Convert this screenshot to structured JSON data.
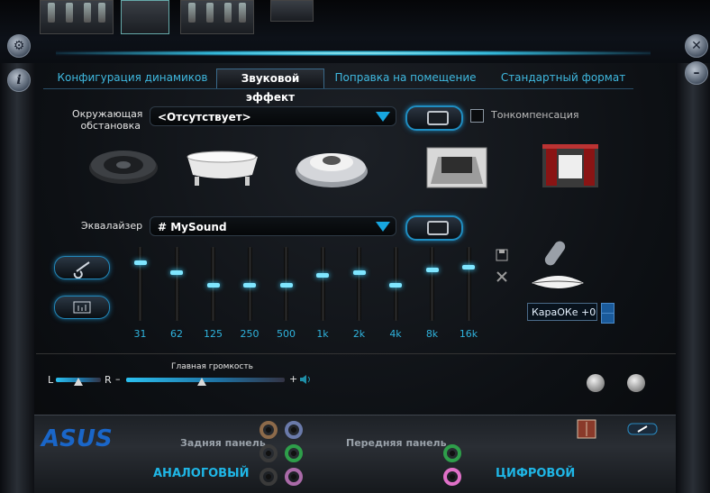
{
  "tabs": [
    {
      "label": "Конфигурация динамиков",
      "active": false
    },
    {
      "label": "Звуковой эффект",
      "active": true
    },
    {
      "label": "Поправка на помещение",
      "active": false
    },
    {
      "label": "Стандартный формат",
      "active": false
    }
  ],
  "environment": {
    "label_line1": "Окружающая",
    "label_line2": "обстановка",
    "value": "<Отсутствует>",
    "loudness_label": "Тонкомпенсация",
    "loudness_checked": false,
    "presets": [
      "stone-disc-icon",
      "bathtub-icon",
      "arena-icon",
      "room-icon",
      "theater-icon"
    ]
  },
  "equalizer": {
    "label": "Эквалайзер",
    "value": "# MySound",
    "bands": [
      {
        "freq": "31",
        "level": 0.8
      },
      {
        "freq": "62",
        "level": 0.66
      },
      {
        "freq": "125",
        "level": 0.48
      },
      {
        "freq": "250",
        "level": 0.48
      },
      {
        "freq": "500",
        "level": 0.48
      },
      {
        "freq": "1k",
        "level": 0.62
      },
      {
        "freq": "2k",
        "level": 0.66
      },
      {
        "freq": "4k",
        "level": 0.48
      },
      {
        "freq": "8k",
        "level": 0.7
      },
      {
        "freq": "16k",
        "level": 0.74
      }
    ]
  },
  "karaoke": {
    "value": "КараОКе  +0"
  },
  "volume": {
    "balance_left": "L",
    "balance_right": "R",
    "label": "Главная громкость",
    "minus": "–",
    "plus": "+",
    "level": 0.48,
    "balance": 0.5
  },
  "bottom": {
    "logo": "ASUS",
    "rear_panel": "Задняя панель",
    "front_panel": "Передняя панель",
    "analog": "АНАЛОГОВЫЙ",
    "digital": "ЦИФРОВОЙ"
  },
  "colors": {
    "accent": "#1fb6e6",
    "glow": "#3fd0ff"
  }
}
